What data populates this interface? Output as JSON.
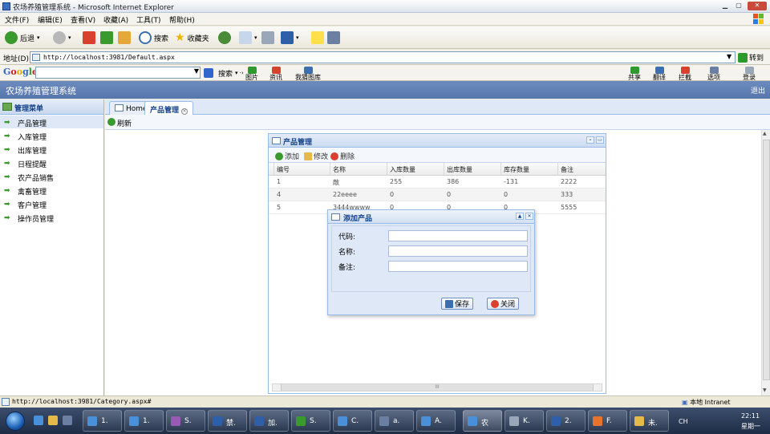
{
  "window": {
    "title": "农场养殖管理系统 - Microsoft Internet Explorer",
    "menu": [
      "文件(F)",
      "编辑(E)",
      "查看(V)",
      "收藏(A)",
      "工具(T)",
      "帮助(H)"
    ],
    "toolbar": {
      "back": "后退",
      "search": "搜索",
      "favorites": "收藏夹"
    },
    "address_label": "地址(D)",
    "address": "http://localhost:3981/Default.aspx",
    "go": "转到",
    "google": {
      "logo": "Google",
      "search_btn": "搜索",
      "items": [
        "图片",
        "资讯",
        "我猜图库"
      ],
      "right_items": [
        "共享",
        "翻译",
        "拦截",
        "选项",
        "登录"
      ]
    },
    "status_url": "http://localhost:3981/Category.aspx#",
    "status_zone": "本地 Intranet"
  },
  "app": {
    "title": "农场养殖管理系统",
    "logout": "退出",
    "sidebar": {
      "header": "管理菜单",
      "items": [
        "产品管理",
        "入库管理",
        "出库管理",
        "日程提醒",
        "农产品销售",
        "禽畜管理",
        "客户管理",
        "操作员管理"
      ]
    },
    "tabs": [
      "Home",
      "产品管理"
    ],
    "refresh": "刷新",
    "panel": {
      "title": "产品管理",
      "actions": [
        "添加",
        "修改",
        "删除"
      ],
      "columns": [
        "编号",
        "名称",
        "入库数量",
        "出库数量",
        "库存数量",
        "备注"
      ],
      "rows": [
        [
          "1",
          "敵",
          "255",
          "386",
          "-131",
          "2222"
        ],
        [
          "4",
          "22eeee",
          "0",
          "0",
          "0",
          "333"
        ],
        [
          "5",
          "3444wwww",
          "0",
          "0",
          "0",
          "5555"
        ]
      ]
    },
    "dialog": {
      "title": "添加产品",
      "fields": [
        {
          "label": "代码:",
          "value": ""
        },
        {
          "label": "名称:",
          "value": ""
        },
        {
          "label": "备注:",
          "value": ""
        }
      ],
      "save": "保存",
      "close": "关闭"
    }
  },
  "taskbar": {
    "tasks": [
      "1.",
      "1.",
      "S.",
      "禁.",
      "加.",
      "S.",
      "C.",
      "a.",
      "A.",
      "农",
      "K.",
      "2.",
      "F.",
      "未."
    ],
    "active_index": 9,
    "lang": "CH",
    "time": "22:11",
    "day": "星期一"
  },
  "colors": {
    "accent": "#15428b",
    "header": "#5b7bb3",
    "panel_bg": "#dfe8f6",
    "border": "#99bbe8"
  }
}
